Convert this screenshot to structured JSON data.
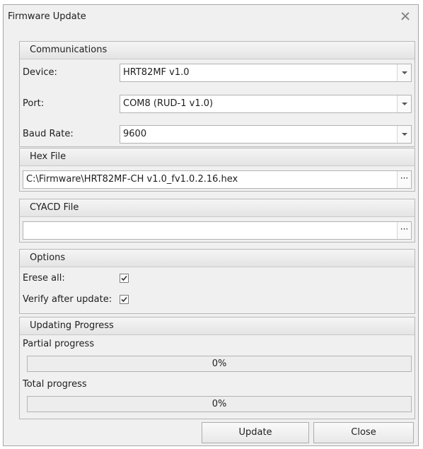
{
  "window": {
    "title": "Firmware Update",
    "close_icon": "close-icon"
  },
  "communications": {
    "header": "Communications",
    "device": {
      "label": "Device:",
      "value": "HRT82MF v1.0"
    },
    "port": {
      "label": "Port:",
      "value": "COM8 (RUD-1 v1.0)"
    },
    "baud": {
      "label": "Baud Rate:",
      "value": "9600"
    }
  },
  "hex_file": {
    "header": "Hex File",
    "value": "C:\\Firmware\\HRT82MF-CH v1.0_fv1.0.2.16.hex",
    "browse": "···"
  },
  "cyacd_file": {
    "header": "CYACD File",
    "value": "",
    "browse": "···"
  },
  "options": {
    "header": "Options",
    "erase_all": {
      "label": "Erese all:",
      "checked": true
    },
    "verify": {
      "label": "Verify after update:",
      "checked": true
    }
  },
  "progress": {
    "header": "Updating Progress",
    "partial": {
      "label": "Partial progress",
      "text": "0%",
      "value": 0
    },
    "total": {
      "label": "Total progress",
      "text": "0%",
      "value": 0
    }
  },
  "buttons": {
    "update": "Update",
    "close": "Close"
  },
  "colors": {
    "window_bg": "#f0f0f0",
    "progress_fill": "#6aa84f"
  }
}
